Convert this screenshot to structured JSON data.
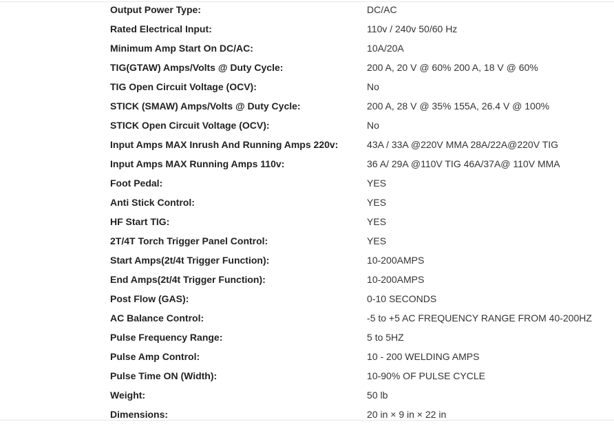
{
  "specs": [
    {
      "label": "Output Power Type:",
      "value": "DC/AC"
    },
    {
      "label": "Rated Electrical Input:",
      "value": "110v / 240v 50/60 Hz"
    },
    {
      "label": "Minimum Amp Start On DC/AC:",
      "value": "10A/20A"
    },
    {
      "label": "TIG(GTAW) Amps/Volts @ Duty Cycle:",
      "value": "200 A, 20 V @ 60% 200 A, 18 V @ 60%"
    },
    {
      "label": "TIG Open Circuit Voltage (OCV):",
      "value": "No"
    },
    {
      "label": "STICK (SMAW) Amps/Volts @ Duty Cycle:",
      "value": "200 A, 28 V @ 35% 155A, 26.4 V @ 100%"
    },
    {
      "label": "STICK Open Circuit Voltage (OCV):",
      "value": "No"
    },
    {
      "label": "Input Amps MAX Inrush And Running Amps 220v:",
      "value": "43A / 33A @220V MMA 28A/22A@220V TIG"
    },
    {
      "label": "Input Amps MAX Running Amps 110v:",
      "value": "36 A/ 29A @110V TIG 46A/37A@ 110V MMA"
    },
    {
      "label": "Foot Pedal:",
      "value": "YES"
    },
    {
      "label": "Anti Stick Control:",
      "value": "YES"
    },
    {
      "label": "HF Start TIG:",
      "value": "YES"
    },
    {
      "label": "2T/4T Torch Trigger Panel Control:",
      "value": "YES"
    },
    {
      "label": "Start Amps(2t/4t Trigger Function):",
      "value": "10-200AMPS"
    },
    {
      "label": "End Amps(2t/4t Trigger Function):",
      "value": "10-200AMPS"
    },
    {
      "label": "Post Flow (GAS):",
      "value": "0-10 SECONDS"
    },
    {
      "label": "AC Balance Control:",
      "value": "-5 to +5 AC FREQUENCY RANGE FROM 40-200HZ"
    },
    {
      "label": "Pulse Frequency Range:",
      "value": "5 to 5HZ"
    },
    {
      "label": "Pulse Amp Control:",
      "value": "10 - 200 WELDING AMPS"
    },
    {
      "label": "Pulse Time ON (Width):",
      "value": "10-90% OF PULSE CYCLE"
    },
    {
      "label": "Weight:",
      "value": "50 lb"
    },
    {
      "label": "Dimensions:",
      "value": "20 in × 9 in × 22 in"
    }
  ]
}
